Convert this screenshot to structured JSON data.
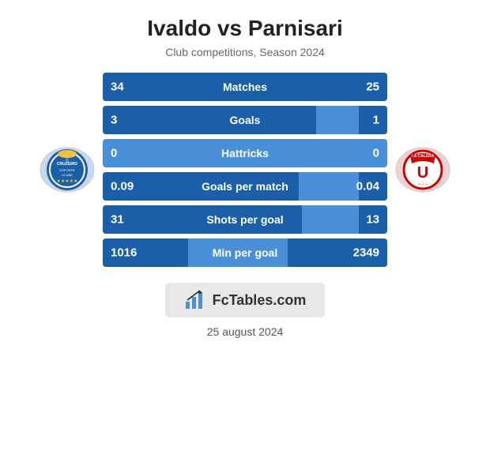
{
  "header": {
    "title": "Ivaldo vs Parnisari",
    "subtitle": "Club competitions, Season 2024"
  },
  "stats": [
    {
      "label": "Matches",
      "left_value": "34",
      "right_value": "25",
      "left_pct": 0.576,
      "right_pct": 0.424
    },
    {
      "label": "Goals",
      "left_value": "3",
      "right_value": "1",
      "left_pct": 0.75,
      "right_pct": 0.1
    },
    {
      "label": "Hattricks",
      "left_value": "0",
      "right_value": "0",
      "left_pct": 0.0,
      "right_pct": 0.0
    },
    {
      "label": "Goals per match",
      "left_value": "0.09",
      "right_value": "0.04",
      "left_pct": 0.69,
      "right_pct": 0.1
    },
    {
      "label": "Shots per goal",
      "left_value": "31",
      "right_value": "13",
      "left_pct": 0.7,
      "right_pct": 0.1
    },
    {
      "label": "Min per goal",
      "left_value": "1016",
      "right_value": "2349",
      "left_pct": 0.3,
      "right_pct": 0.35
    }
  ],
  "badge": {
    "text": "FcTables.com"
  },
  "date": "25 august 2024",
  "colors": {
    "bar_bg": "#4a90d9",
    "bar_fill": "#1a5fa8"
  }
}
